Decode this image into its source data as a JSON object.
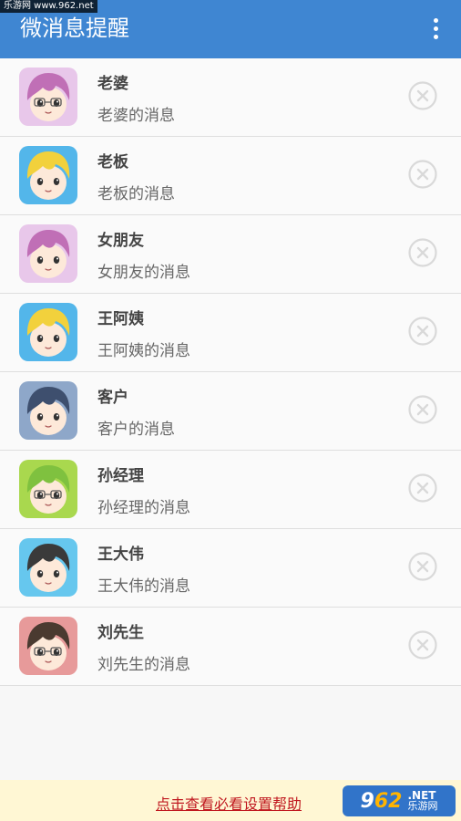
{
  "watermark": "乐游网 www.962.net",
  "appbar": {
    "title": "微消息提醒"
  },
  "contacts": [
    {
      "name": "老婆",
      "message": "老婆的消息",
      "avatar": {
        "bg": "#e8c7ea",
        "hair": "#c06fb6",
        "glasses": true
      }
    },
    {
      "name": "老板",
      "message": "老板的消息",
      "avatar": {
        "bg": "#53b6ea",
        "hair": "#f2d13c",
        "glasses": false
      }
    },
    {
      "name": "女朋友",
      "message": "女朋友的消息",
      "avatar": {
        "bg": "#e8c7ea",
        "hair": "#c06fb6",
        "glasses": false
      }
    },
    {
      "name": "王阿姨",
      "message": "王阿姨的消息",
      "avatar": {
        "bg": "#53b6ea",
        "hair": "#f2d13c",
        "glasses": false
      }
    },
    {
      "name": "客户",
      "message": "客户的消息",
      "avatar": {
        "bg": "#8ea7c9",
        "hair": "#3e4f6e",
        "glasses": false
      }
    },
    {
      "name": "孙经理",
      "message": "孙经理的消息",
      "avatar": {
        "bg": "#a9d84e",
        "hair": "#7fc13f",
        "glasses": true
      }
    },
    {
      "name": "王大伟",
      "message": "王大伟的消息",
      "avatar": {
        "bg": "#66c7ee",
        "hair": "#3a3a3a",
        "glasses": false
      }
    },
    {
      "name": "刘先生",
      "message": "刘先生的消息",
      "avatar": {
        "bg": "#e79a9a",
        "hair": "#4a3a30",
        "glasses": true
      }
    }
  ],
  "footer": {
    "help_link": "点击查看必看设置帮助"
  },
  "brand": {
    "num_a": "9",
    "num_b": "62",
    "net": ".NET",
    "cn": "乐游网"
  },
  "colors": {
    "appbar": "#3f86d2",
    "close_icon": "#d9d9d9",
    "footer_bg": "#fff7d4",
    "help_link": "#c0181f"
  }
}
